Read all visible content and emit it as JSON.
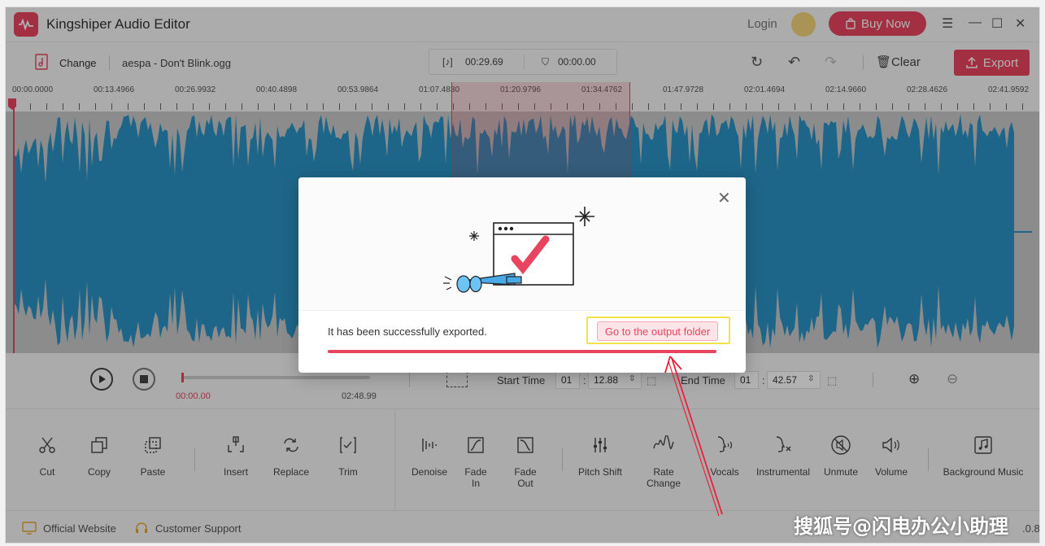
{
  "app": {
    "title": "Kingshiper Audio Editor",
    "login": "Login",
    "buy_now": "Buy Now",
    "accent": "#e8445f"
  },
  "toolbar": {
    "change": "Change",
    "filename": "aespa - Don't Blink.ogg",
    "selection_length": "00:29.69",
    "other_time": "00:00.00",
    "clear": "Clear",
    "export": "Export"
  },
  "ruler": {
    "labels": [
      "00:00.0000",
      "00:13.4966",
      "00:26.9932",
      "00:40.4898",
      "00:53.9864",
      "01:07.4830",
      "01:20.9796",
      "01:34.4762",
      "01:47.9728",
      "02:01.4694",
      "02:14.9660",
      "02:28.4626",
      "02:41.9592"
    ]
  },
  "transport": {
    "current": "00:00.00",
    "total": "02:48.99",
    "start_label": "Start Time",
    "start_min": "01",
    "start_sec": "12.88",
    "end_label": "End Time",
    "end_min": "01",
    "end_sec": "42.57"
  },
  "tools": {
    "cut": "Cut",
    "copy": "Copy",
    "paste": "Paste",
    "insert": "Insert",
    "replace": "Replace",
    "trim": "Trim",
    "denoise": "Denoise",
    "fade_in": "Fade In",
    "fade_out": "Fade Out",
    "pitch_shift": "Pitch Shift",
    "rate_change": "Rate Change",
    "vocals": "Vocals",
    "instrumental": "Instrumental",
    "unmute": "Unmute",
    "volume": "Volume",
    "background_music": "Background Music"
  },
  "footer": {
    "official_website": "Official Website",
    "customer_support": "Customer Support",
    "version_tail": ".0.8"
  },
  "modal": {
    "message": "It has been successfully exported.",
    "output_button": "Go to the output folder"
  },
  "watermark": "搜狐号@闪电办公小助理"
}
